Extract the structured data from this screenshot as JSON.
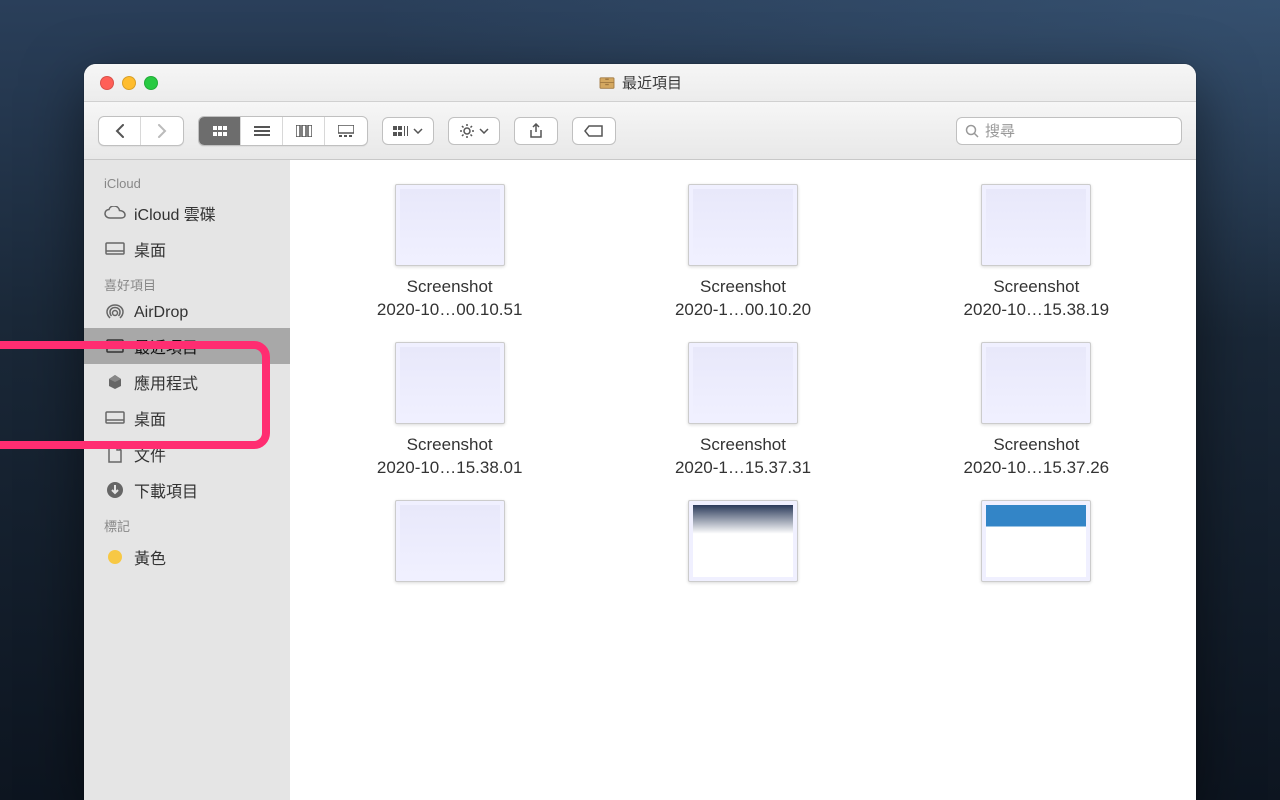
{
  "window": {
    "title": "最近項目"
  },
  "toolbar": {
    "search_placeholder": "搜尋"
  },
  "sidebar": {
    "sections": [
      {
        "label": "iCloud",
        "items": [
          {
            "icon": "cloud",
            "label": "iCloud 雲碟"
          },
          {
            "icon": "desktop",
            "label": "桌面"
          }
        ]
      },
      {
        "label": "喜好項目",
        "items": [
          {
            "icon": "airdrop",
            "label": "AirDrop"
          },
          {
            "icon": "recents",
            "label": "最近項目",
            "selected": true
          },
          {
            "icon": "apps",
            "label": "應用程式"
          },
          {
            "icon": "desktop",
            "label": "桌面"
          },
          {
            "icon": "documents",
            "label": "文件"
          },
          {
            "icon": "downloads",
            "label": "下載項目"
          }
        ]
      },
      {
        "label": "標記",
        "items": [
          {
            "icon": "tag",
            "label": "黃色",
            "color": "#f7c844"
          }
        ]
      }
    ]
  },
  "files": [
    {
      "name_line1": "Screenshot",
      "name_line2": "2020-10…00.10.51"
    },
    {
      "name_line1": "Screenshot",
      "name_line2": "2020-1…00.10.20"
    },
    {
      "name_line1": "Screenshot",
      "name_line2": "2020-10…15.38.19"
    },
    {
      "name_line1": "Screenshot",
      "name_line2": "2020-10…15.38.01"
    },
    {
      "name_line1": "Screenshot",
      "name_line2": "2020-1…15.37.31"
    },
    {
      "name_line1": "Screenshot",
      "name_line2": "2020-10…15.37.26"
    },
    {
      "name_line1": "",
      "name_line2": ""
    },
    {
      "name_line1": "",
      "name_line2": ""
    },
    {
      "name_line1": "",
      "name_line2": ""
    }
  ]
}
